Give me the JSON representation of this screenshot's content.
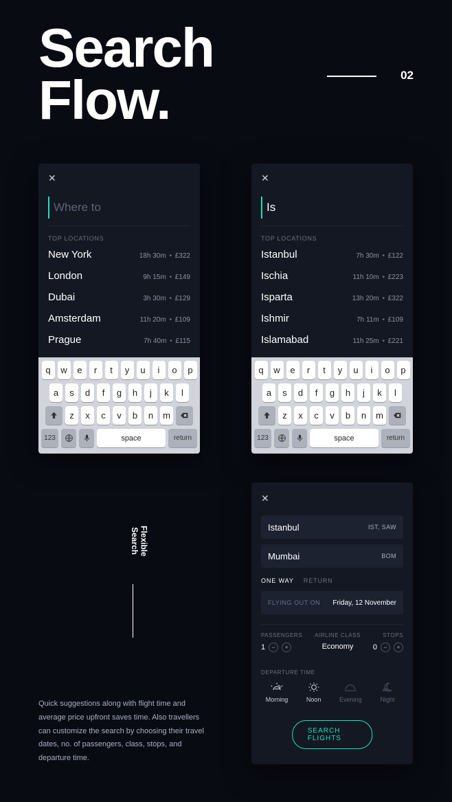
{
  "hero": {
    "title_line1": "Search",
    "title_line2": "Flow.",
    "page_number": "02"
  },
  "panels": {
    "a": {
      "search_placeholder": "Where to",
      "top_label": "TOP LOCATIONS",
      "items": [
        {
          "name": "New York",
          "duration": "18h 30m",
          "price": "£322"
        },
        {
          "name": "London",
          "duration": "9h 15m",
          "price": "£149"
        },
        {
          "name": "Dubai",
          "duration": "3h 30m",
          "price": "£129"
        },
        {
          "name": "Amsterdam",
          "duration": "11h 20m",
          "price": "£109"
        },
        {
          "name": "Prague",
          "duration": "7h 40m",
          "price": "£115"
        }
      ]
    },
    "b": {
      "search_value": "Is",
      "top_label": "TOP LOCATIONS",
      "items": [
        {
          "name": "Istanbul",
          "duration": "7h 30m",
          "price": "£122"
        },
        {
          "name": "Ischia",
          "duration": "11h 10m",
          "price": "£223"
        },
        {
          "name": "Isparta",
          "duration": "13h 20m",
          "price": "£322"
        },
        {
          "name": "Ishmir",
          "duration": "7h 11m",
          "price": "£109"
        },
        {
          "name": "Islamabad",
          "duration": "11h 25m",
          "price": "£221"
        }
      ]
    }
  },
  "keyboard": {
    "row1": [
      "q",
      "w",
      "e",
      "r",
      "t",
      "y",
      "u",
      "i",
      "o",
      "p"
    ],
    "row2": [
      "a",
      "s",
      "d",
      "f",
      "g",
      "h",
      "j",
      "k",
      "l"
    ],
    "row3": [
      "z",
      "x",
      "c",
      "v",
      "b",
      "n",
      "m"
    ],
    "mode": "123",
    "space": "space",
    "return": "return"
  },
  "panel_c": {
    "origin": {
      "city": "Istanbul",
      "code": "IST, SAW"
    },
    "dest": {
      "city": "Mumbai",
      "code": "BOM"
    },
    "trip_tabs": {
      "one_way": "ONE WAY",
      "return": "RETURN"
    },
    "date_label": "FLYING OUT ON",
    "date_value": "Friday, 12 November",
    "opts": {
      "passengers_label": "PASSENGERS",
      "passengers_value": "1",
      "class_label": "AIRLINE CLASS",
      "class_value": "Economy",
      "stops_label": "STOPS",
      "stops_value": "0"
    },
    "departure_label": "DEPARTURE TIME",
    "times": {
      "morning": "Morning",
      "noon": "Noon",
      "evening": "Evening",
      "night": "Night"
    },
    "cta": "SEARCH FLIGHTS"
  },
  "side": {
    "label_line1": "Flexible",
    "label_line2": "Search"
  },
  "paragraph": "Quick suggestions along with flight time and average price upfront saves time. Also travellers can customize the search by choosing their travel dates, no. of passengers, class, stops, and departure time."
}
